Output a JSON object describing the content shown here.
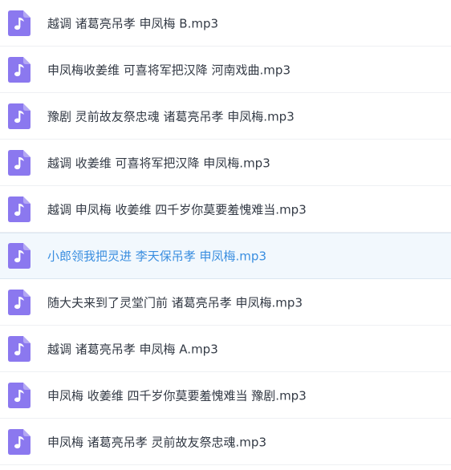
{
  "colors": {
    "icon_purple": "#8b78ef",
    "text": "#333a45",
    "selected_text": "#3a8ee0",
    "selected_bg": "#f2f8fd"
  },
  "files": [
    {
      "name": "越调 诸葛亮吊孝 申凤梅 B.mp3",
      "icon": "music-file-icon",
      "selected": false
    },
    {
      "name": "申凤梅收姜维 可喜将军把汉降 河南戏曲.mp3",
      "icon": "music-file-icon",
      "selected": false
    },
    {
      "name": "豫剧 灵前故友祭忠魂 诸葛亮吊孝 申凤梅.mp3",
      "icon": "music-file-icon",
      "selected": false
    },
    {
      "name": "越调 收姜维 可喜将军把汉降 申凤梅.mp3",
      "icon": "music-file-icon",
      "selected": false
    },
    {
      "name": "越调 申凤梅 收姜维 四千岁你莫要羞愧难当.mp3",
      "icon": "music-file-icon",
      "selected": false
    },
    {
      "name": "小郎领我把灵进 李天保吊孝 申凤梅.mp3",
      "icon": "music-file-icon",
      "selected": true
    },
    {
      "name": "随大夫来到了灵堂门前 诸葛亮吊孝 申凤梅.mp3",
      "icon": "music-file-icon",
      "selected": false
    },
    {
      "name": "越调 诸葛亮吊孝 申凤梅 A.mp3",
      "icon": "music-file-icon",
      "selected": false
    },
    {
      "name": "申凤梅 收姜维 四千岁你莫要羞愧难当 豫剧.mp3",
      "icon": "music-file-icon",
      "selected": false
    },
    {
      "name": "申凤梅 诸葛亮吊孝 灵前故友祭忠魂.mp3",
      "icon": "music-file-icon",
      "selected": false
    }
  ]
}
